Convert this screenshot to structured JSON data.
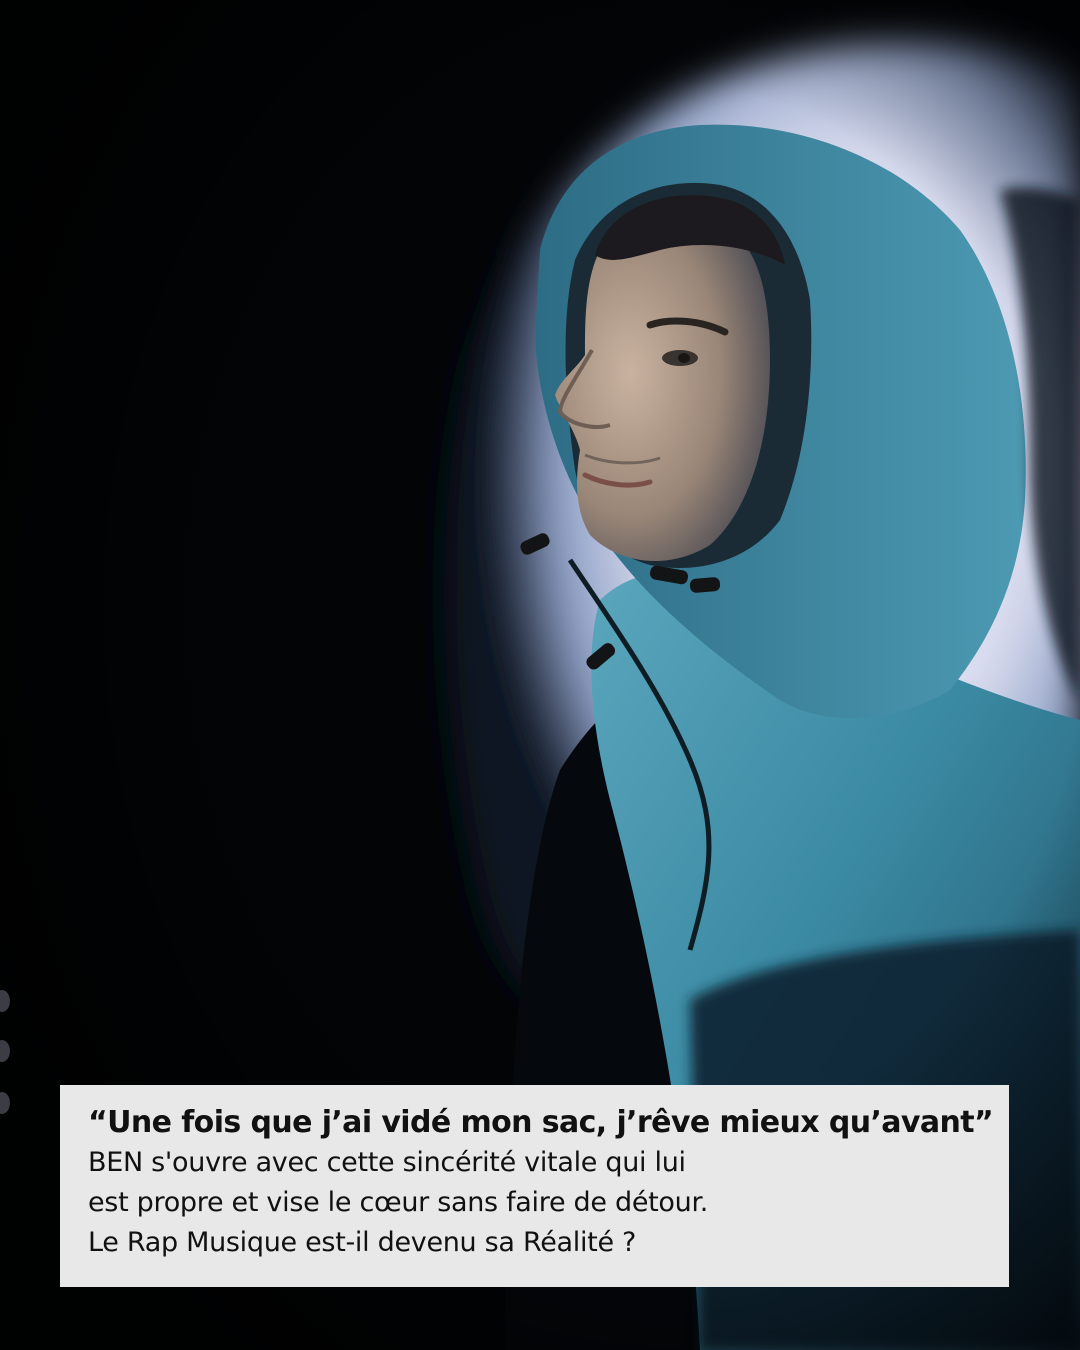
{
  "caption": {
    "quote": "“Une fois que j’ai vidé mon sac, j’rêve mieux qu’avant”",
    "lines": [
      "BEN s'ouvre avec cette sincérité vitale qui lui",
      "est propre et vise le cœur sans faire de détour.",
      "Le Rap Musique est-il devenu sa Réalité ?"
    ]
  },
  "colors": {
    "background": "#020406",
    "light_backdrop": "#e6e8f4",
    "jacket": "#3f8fa6",
    "caption_box": "#e8e8e8",
    "caption_text": "#111111"
  },
  "carousel_dots": 3
}
